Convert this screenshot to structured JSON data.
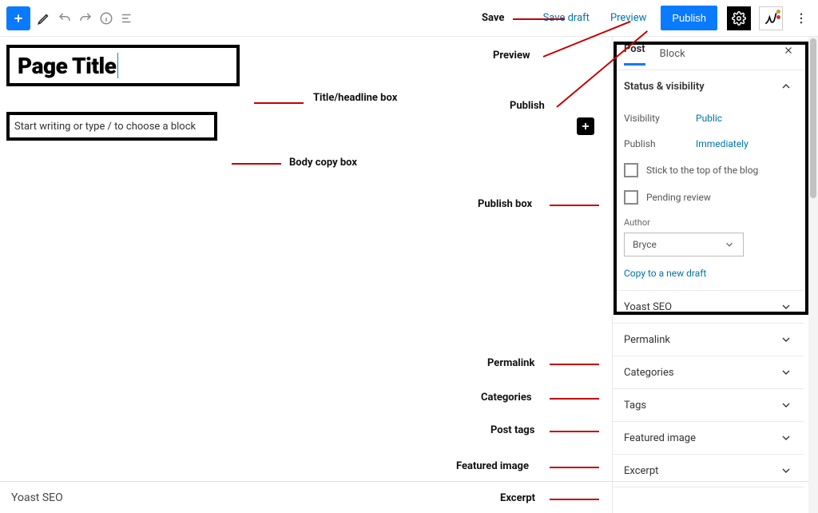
{
  "toolbar": {
    "save_draft": "Save draft",
    "preview": "Preview",
    "publish": "Publish"
  },
  "editor": {
    "page_title": "Page Title",
    "body_placeholder": "Start writing or type / to choose a block"
  },
  "sidebar": {
    "tabs": {
      "post": "Post",
      "block": "Block"
    },
    "panels": {
      "status": {
        "title": "Status & visibility",
        "visibility_label": "Visibility",
        "visibility_value": "Public",
        "publish_label": "Publish",
        "publish_value": "Immediately",
        "stick_label": "Stick to the top of the blog",
        "pending_label": "Pending review",
        "author_label": "Author",
        "author_value": "Bryce",
        "copy_link": "Copy to a new draft"
      },
      "yoast": "Yoast SEO",
      "permalink": "Permalink",
      "categories": "Categories",
      "tags": "Tags",
      "featured": "Featured image",
      "excerpt": "Excerpt"
    }
  },
  "status_bar": {
    "label": "Yoast SEO"
  },
  "annotations": {
    "save": "Save",
    "preview": "Preview",
    "publish": "Publish",
    "title_box": "Title/headline box",
    "body_box": "Body copy box",
    "publish_box": "Publish box",
    "permalink": "Permalink",
    "categories": "Categories",
    "tags": "Post tags",
    "featured": "Featured image",
    "excerpt": "Excerpt"
  }
}
